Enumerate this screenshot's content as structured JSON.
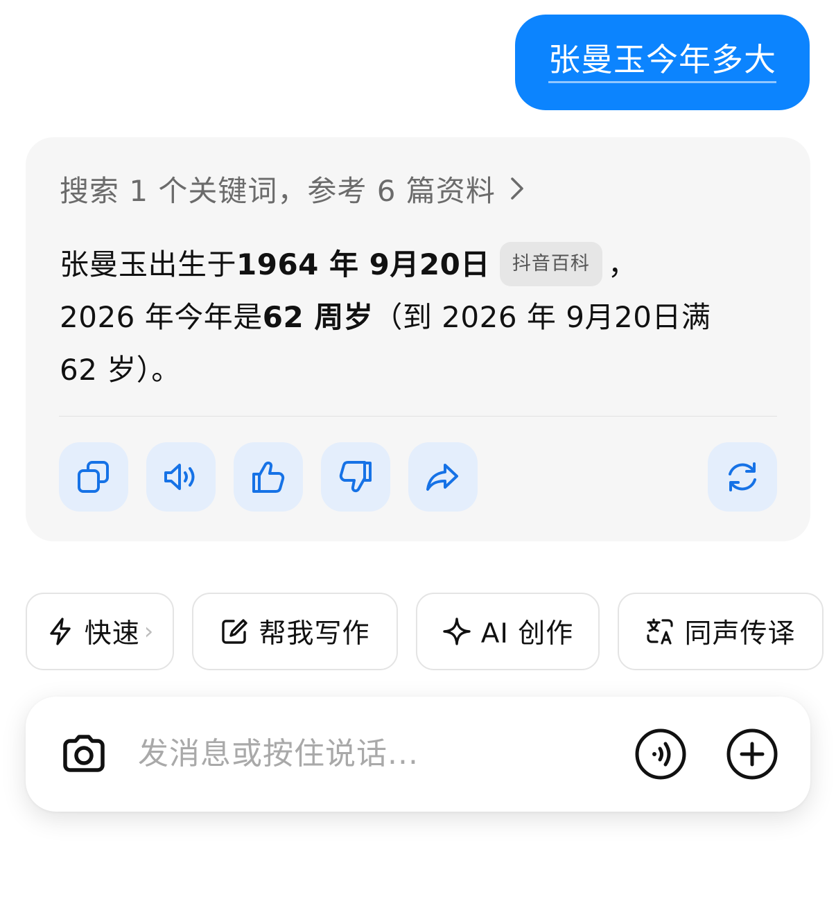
{
  "user_message": {
    "text": "张曼玉今年多大"
  },
  "answer": {
    "search_summary": "搜索 1 个关键词，参考 6 篇资料",
    "line1_a": "张曼玉出生于",
    "line1_bold": "1964 年 9月20日",
    "source_chip": "抖音百科",
    "line1_c": "，",
    "line2_a": "2026 年今年是",
    "line2_bold": "62 周岁",
    "line2_c": "（到 2026 年 9月20日满",
    "line3": "62 岁）。",
    "actions": [
      {
        "icon": "copy-icon"
      },
      {
        "icon": "speaker-icon"
      },
      {
        "icon": "thumbs-up-icon"
      },
      {
        "icon": "thumbs-down-icon"
      },
      {
        "icon": "share-icon"
      },
      {
        "icon": "regenerate-icon"
      }
    ],
    "accent_color": "#1672e6"
  },
  "quick_actions": [
    {
      "label": "快速",
      "icon": "lightning-icon",
      "chevron": "›"
    },
    {
      "label": "帮我写作",
      "icon": "edit-icon"
    },
    {
      "label": "AI 创作",
      "icon": "sparkle-icon"
    },
    {
      "label": "同声传译",
      "icon": "translate-icon"
    }
  ],
  "input": {
    "placeholder": "发消息或按住说话...",
    "camera_icon": "camera-icon",
    "voice_icon": "voice-icon",
    "plus_icon": "plus-icon"
  },
  "colors": {
    "user_bubble": "#0c84fe",
    "card_background": "#f6f6f6",
    "action_button_bg": "#e4eefc"
  }
}
